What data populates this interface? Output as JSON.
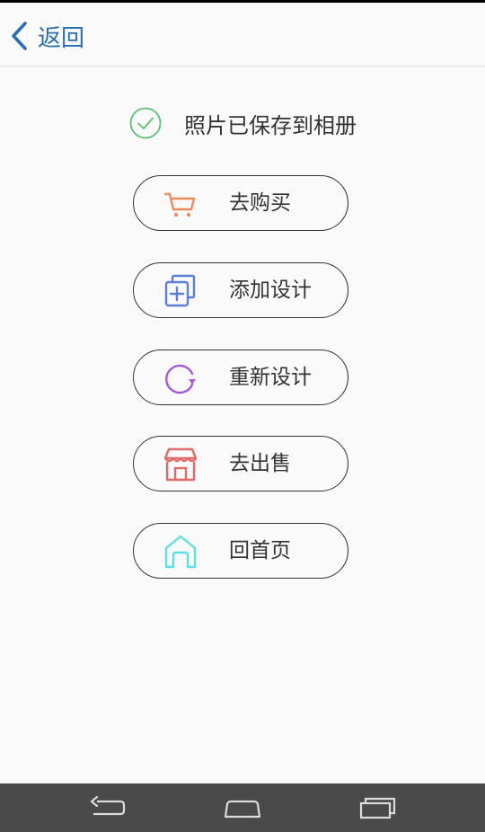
{
  "header": {
    "back_label": "返回"
  },
  "status": {
    "text": "照片已保存到相册",
    "icon": "check-circle-icon",
    "color": "#5cbf73"
  },
  "actions": [
    {
      "label": "去购买",
      "icon": "shopping-cart-icon",
      "color": "#ee8a5e"
    },
    {
      "label": "添加设计",
      "icon": "add-layer-icon",
      "color": "#5b7fd8"
    },
    {
      "label": "重新设计",
      "icon": "refresh-icon",
      "color": "#a35ad8"
    },
    {
      "label": "去出售",
      "icon": "storefront-icon",
      "color": "#e06b6b"
    },
    {
      "label": "回首页",
      "icon": "home-icon",
      "color": "#5fe0e0"
    }
  ],
  "navbar": {
    "buttons": [
      "back-icon",
      "home-icon",
      "recents-icon"
    ]
  },
  "colors": {
    "accent": "#2a6fb0",
    "text": "#333333",
    "background": "#fafafa",
    "navbar": "#4a4a4a"
  }
}
